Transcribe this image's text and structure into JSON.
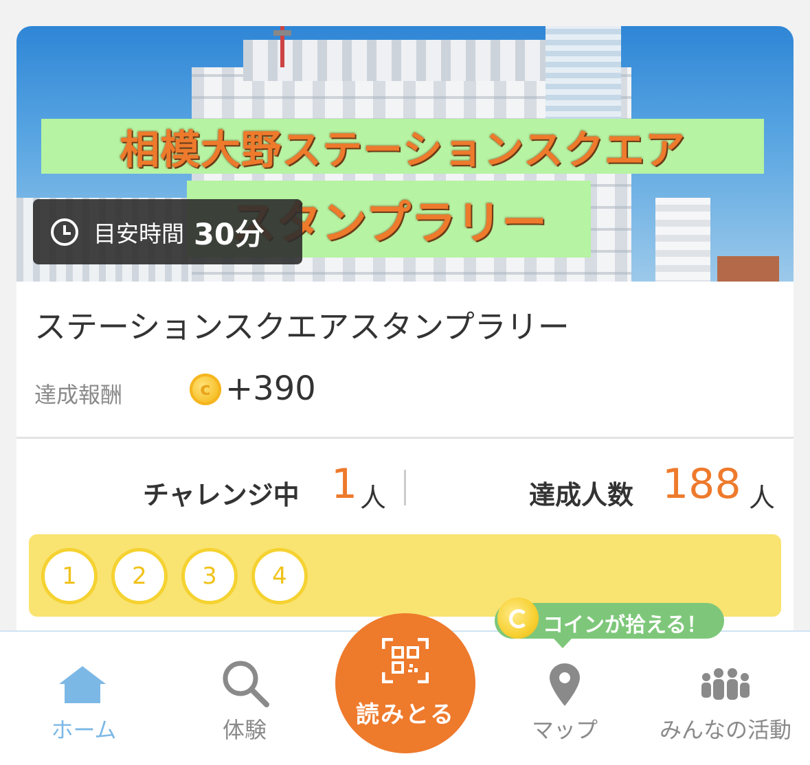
{
  "hero": {
    "banner_line1": "相模大野ステーションスクエア",
    "banner_line2": "スタンプラリー",
    "time_label": "目安時間",
    "time_value": "30分"
  },
  "rally": {
    "title": "ステーションスクエアスタンプラリー",
    "reward_label": "達成報酬",
    "reward_value": "+390"
  },
  "stats": {
    "challenging_label": "チャレンジ中",
    "challenging_count": "1",
    "challenging_unit": "人",
    "achieved_label": "達成人数",
    "achieved_count": "188",
    "achieved_unit": "人"
  },
  "stamps": [
    "1",
    "2",
    "3",
    "4"
  ],
  "tooltip": {
    "text": "コインが拾える！"
  },
  "nav": {
    "home": "ホーム",
    "experience": "体験",
    "scan": "読みとる",
    "map": "マップ",
    "activity": "みんなの活動"
  },
  "colors": {
    "accent": "#ee7a2c",
    "active_tab": "#7cb8e6",
    "stamp_bar": "#f9e371",
    "tooltip": "#7ec77a"
  },
  "icons": [
    "clock-icon",
    "coin-icon",
    "home-icon",
    "search-icon",
    "qr-code-icon",
    "map-pin-icon",
    "people-icon"
  ]
}
